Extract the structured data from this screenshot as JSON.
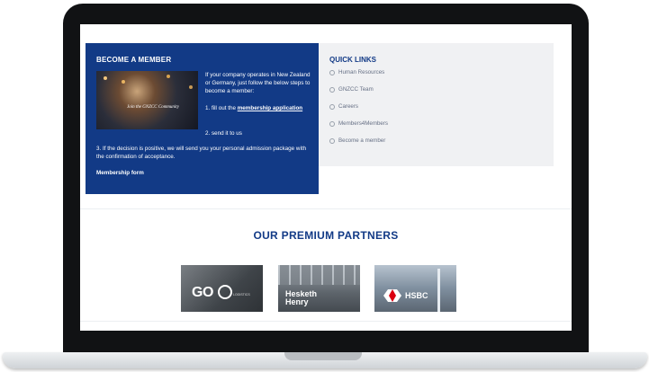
{
  "member": {
    "title": "BECOME A MEMBER",
    "photo_caption": "Join the GNZCC Community",
    "intro": "If your company operates in New Zealand or Germany, just follow the below steps to become a member:",
    "step1_prefix": "1. fill out the ",
    "step1_link": "membership application",
    "step2": "2. send it to us",
    "step3": "3. If the decision is positive, we will send you your personal admission package with the confirmation of acceptance.",
    "form_link": "Membership form"
  },
  "quick_links": {
    "title": "QUICK LINKS",
    "items": [
      {
        "label": "Human Resources"
      },
      {
        "label": "GNZCC Team"
      },
      {
        "label": "Careers"
      },
      {
        "label": "Members4Members"
      },
      {
        "label": "Become a member"
      }
    ]
  },
  "partners": {
    "title": "OUR PREMIUM PARTNERS",
    "logos": [
      {
        "name": "GO",
        "sub": "LOGISTICS"
      },
      {
        "name_line1": "Hesketh",
        "name_line2": "Henry"
      },
      {
        "name": "HSBC"
      }
    ]
  },
  "colors": {
    "brand_blue": "#123a86",
    "panel_gray": "#f0f1f3"
  }
}
